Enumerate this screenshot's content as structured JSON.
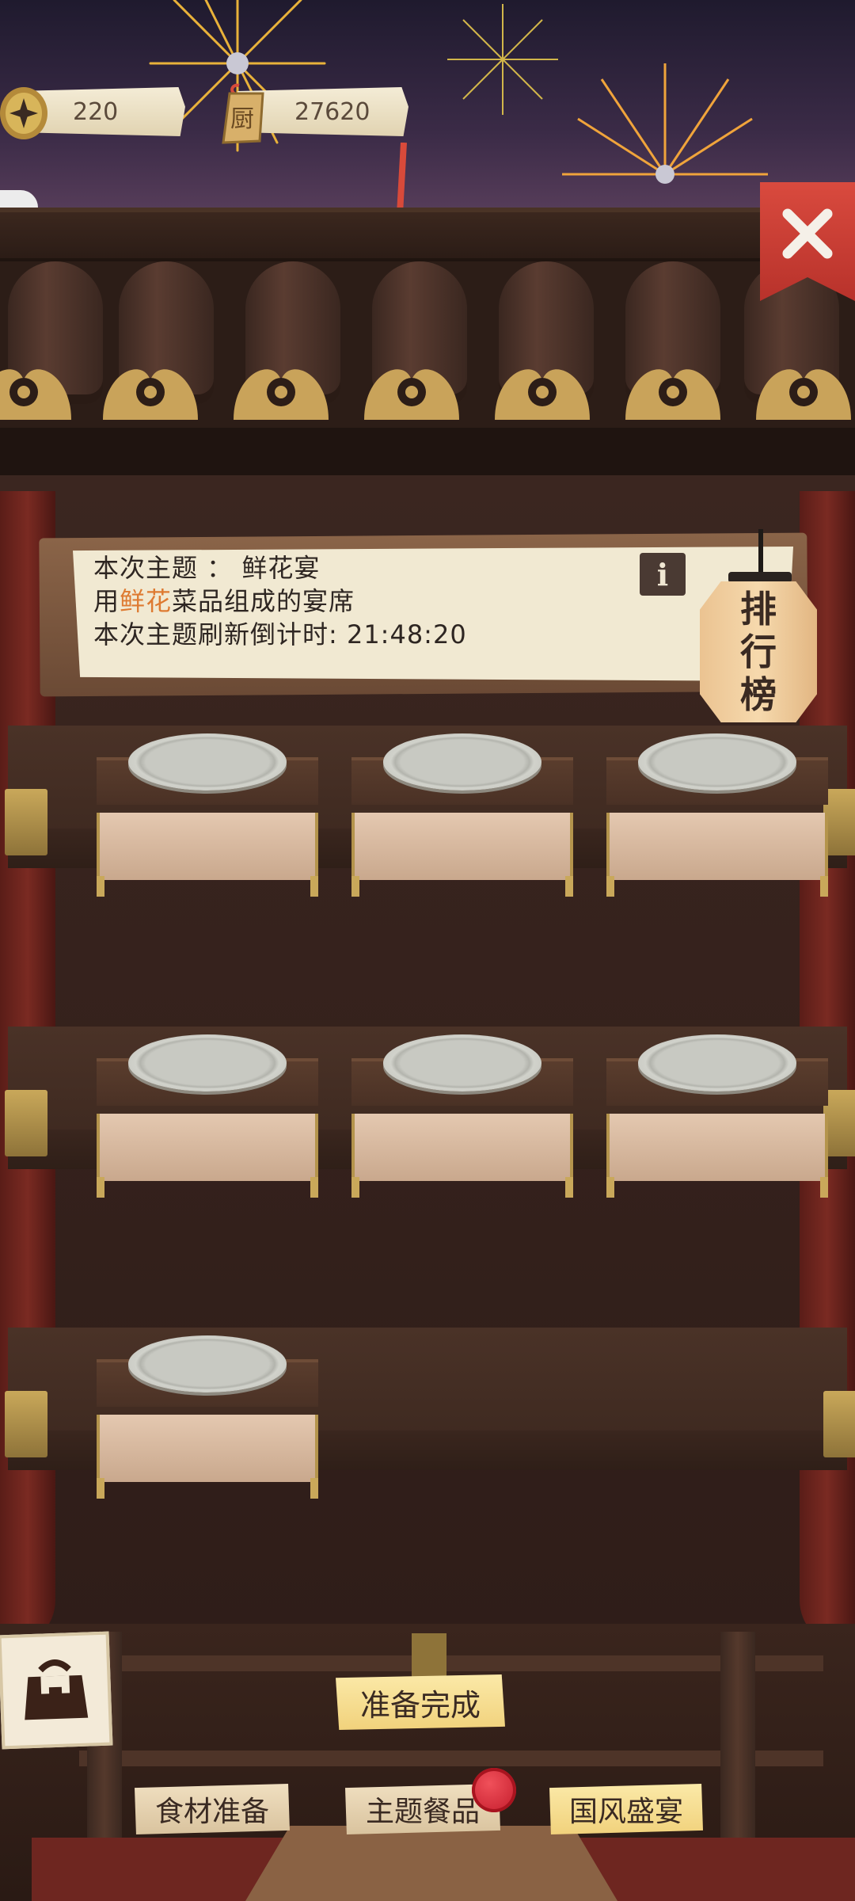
{
  "currency": {
    "coins": "220",
    "chef_tickets": "27620"
  },
  "topic": {
    "line1": "本次主题 ： 鲜花宴",
    "line2_prefix": "用",
    "line2_accent": "鲜花",
    "line2_suffix": "菜品组成的宴席",
    "line3": "本次主题刷新倒计时: 21:48:20",
    "info_glyph": "i"
  },
  "leaderboard": {
    "chars": [
      "排",
      "行",
      "榜"
    ]
  },
  "close_glyph": "✕",
  "side_pull_glyph": "〉",
  "ticket_glyph": "厨",
  "buttons": {
    "ready": "准备完成",
    "tabs": [
      "食材准备",
      "主题餐品",
      "国风盛宴"
    ]
  },
  "colors": {
    "accent": "#de7a31",
    "close_red": "#c8362d",
    "badge_red": "#d62236",
    "gold": "#c9a85a"
  },
  "icons": {
    "coin": "coin-icon",
    "ticket": "ticket-icon",
    "close": "close-icon",
    "info": "info-icon",
    "bag": "bag-icon",
    "side_pull": "chevron-right-icon"
  }
}
